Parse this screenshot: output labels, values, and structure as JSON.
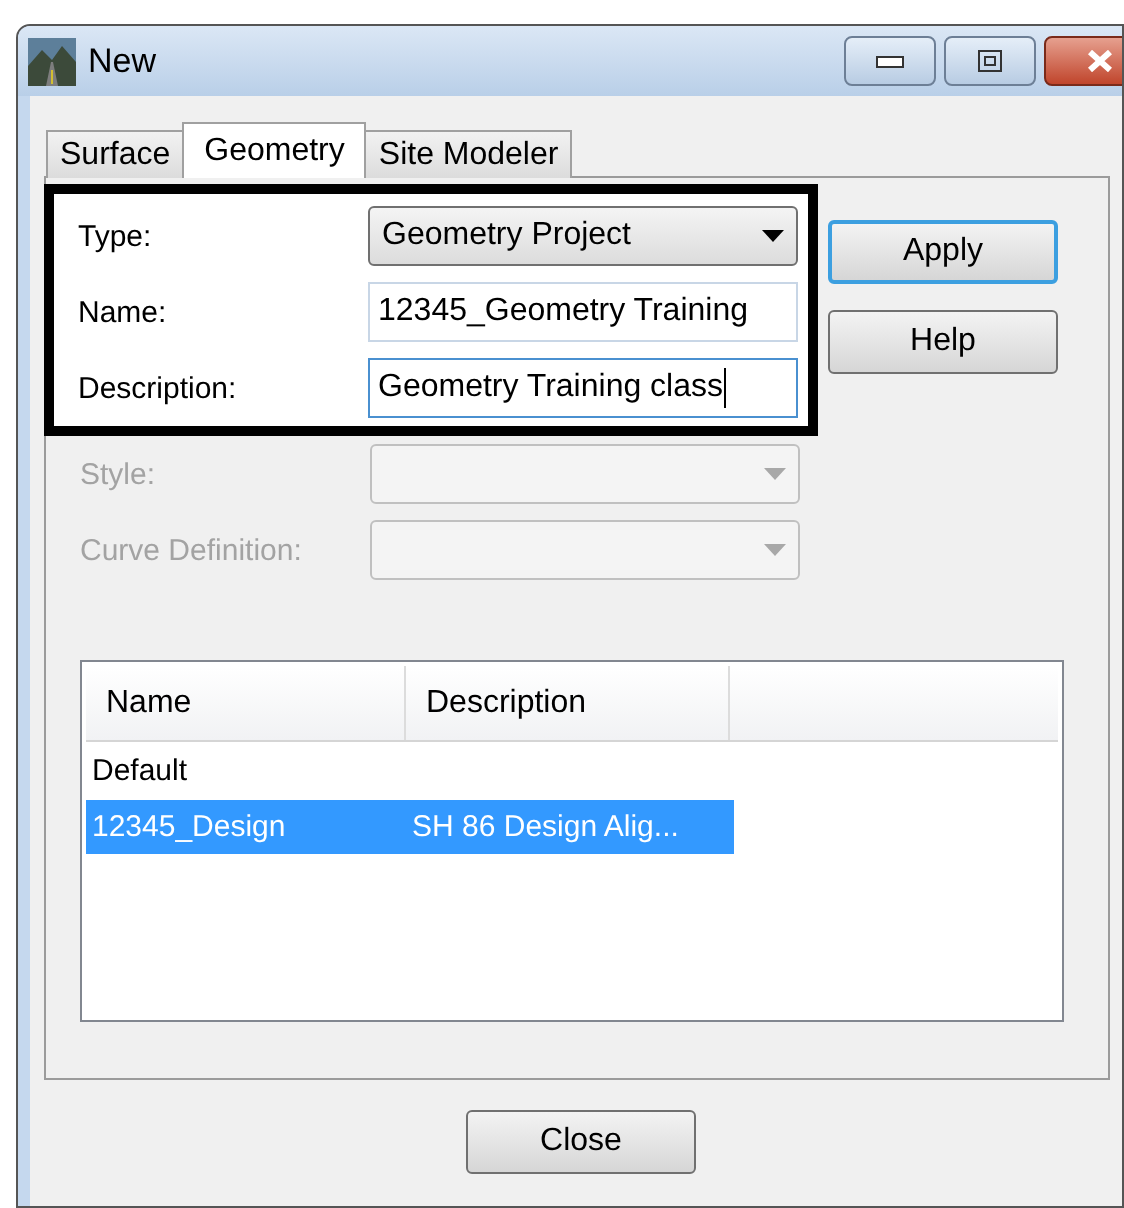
{
  "window": {
    "title": "New"
  },
  "tabs": [
    {
      "label": "Surface",
      "selected": false
    },
    {
      "label": "Geometry",
      "selected": true
    },
    {
      "label": "Site Modeler",
      "selected": false
    }
  ],
  "highlighted_fields": [
    {
      "kind": "dropdown",
      "label": "Type:",
      "value": "Geometry Project",
      "disabled": false
    },
    {
      "kind": "text",
      "label": "Name:",
      "value": "12345_Geometry Training",
      "disabled": false,
      "focused": false
    },
    {
      "kind": "text",
      "label": "Description:",
      "value": "Geometry Training class",
      "disabled": false,
      "focused": true
    }
  ],
  "fields": [
    {
      "kind": "dropdown",
      "label": "Style:",
      "disabled": true
    },
    {
      "kind": "dropdown",
      "label": "Curve Definition:",
      "disabled": true
    }
  ],
  "buttons": [
    {
      "label": "Apply",
      "default": true
    },
    {
      "label": "Help",
      "default": false
    }
  ],
  "list": {
    "columns": [
      "Name",
      "Description"
    ],
    "rows": [
      {
        "name": "Default",
        "selected": false
      },
      {
        "name": "12345_Design",
        "description": "SH 86 Design Alig...",
        "selected": true
      }
    ]
  },
  "close_button": "Close"
}
